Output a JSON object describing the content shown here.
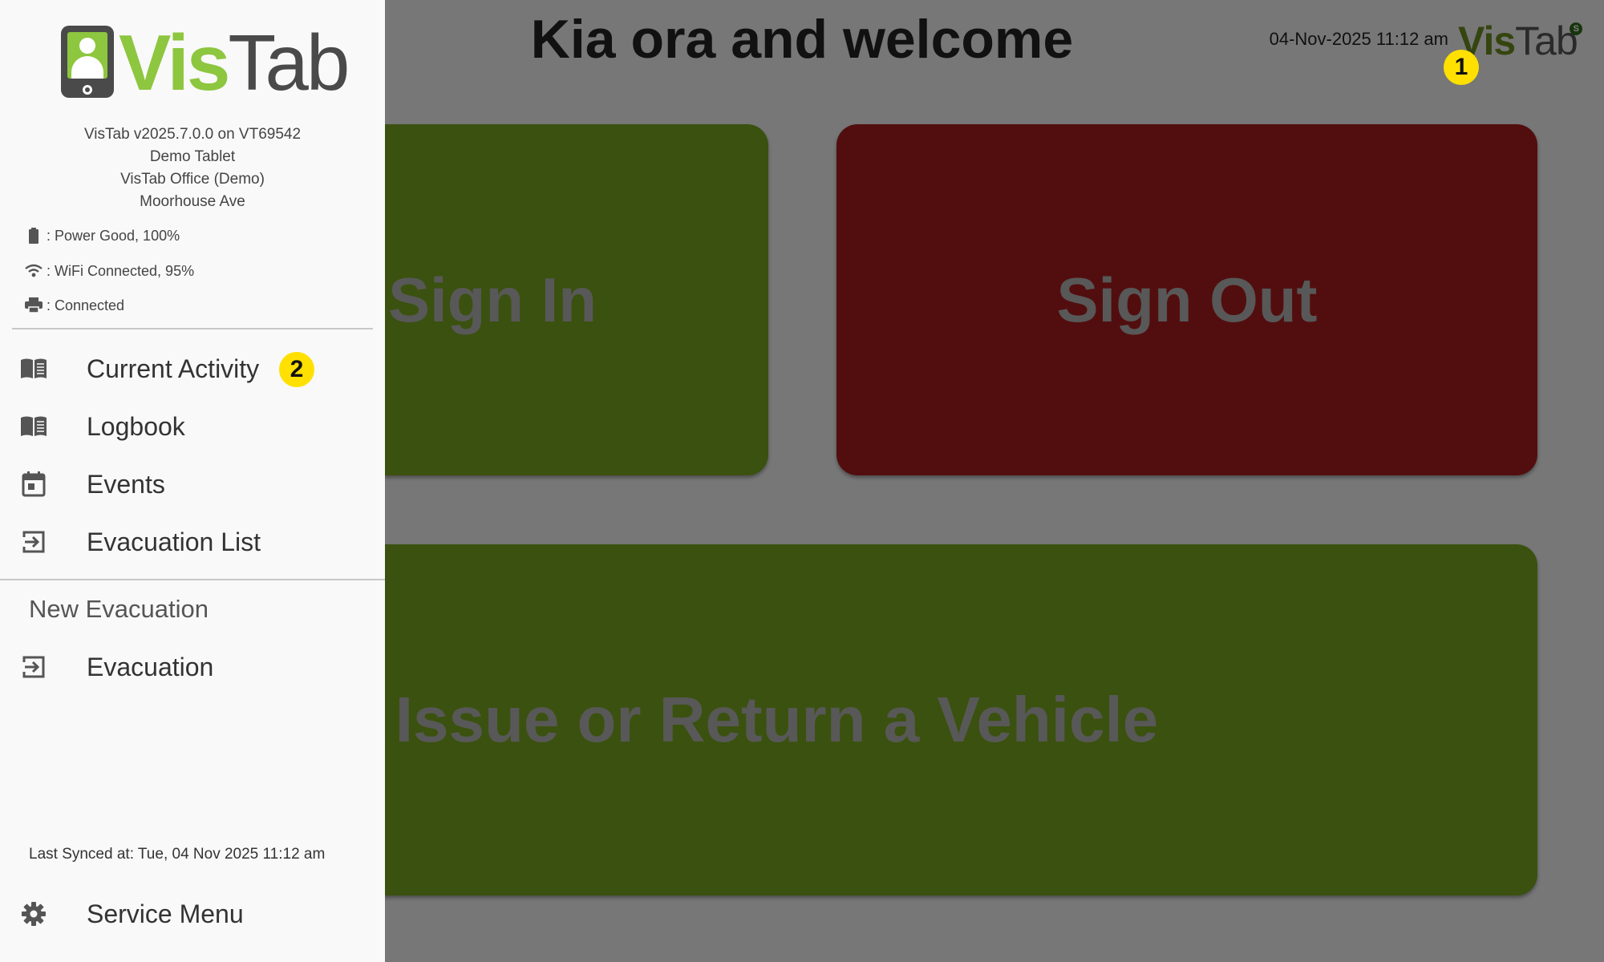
{
  "header": {
    "welcome": "Kia ora and welcome",
    "datetime": "04-Nov-2025 11:12 am",
    "logo_vis": "Vis",
    "logo_tab": "Tab",
    "logo_badge": "S"
  },
  "tiles": {
    "sign_in": "Sign In",
    "sign_out": "Sign Out",
    "vehicle": "Issue or Return a Vehicle"
  },
  "markers": {
    "one": "1",
    "two": "2"
  },
  "drawer": {
    "logo_vis": "Vis",
    "logo_tab": "Tab",
    "device_info": [
      "VisTab v2025.7.0.0 on VT69542",
      "Demo Tablet",
      "VisTab Office (Demo)",
      "Moorhouse Ave"
    ],
    "status": {
      "power": ": Power Good, 100%",
      "wifi": ": WiFi Connected, 95%",
      "printer": ": Connected"
    },
    "nav": {
      "current_activity": "Current Activity",
      "logbook": "Logbook",
      "events": "Events",
      "evacuation_list": "Evacuation List",
      "section_title": "New Evacuation",
      "evacuation": "Evacuation",
      "service_menu": "Service Menu"
    },
    "last_synced": "Last Synced at: Tue, 04 Nov 2025 11:12 am"
  },
  "colors": {
    "green_tile": "#76a31f",
    "red_tile": "#a51d1d",
    "marker": "#ffe000",
    "logo_green": "#8dc63f"
  },
  "icons": {
    "power": "battery-icon",
    "wifi": "wifi-icon",
    "printer": "printer-icon",
    "current_activity": "book-icon",
    "logbook": "book-icon",
    "events": "calendar-icon",
    "evacuation_list": "exit-arrow-icon",
    "evacuation": "exit-arrow-icon",
    "service_menu": "gear-icon"
  }
}
